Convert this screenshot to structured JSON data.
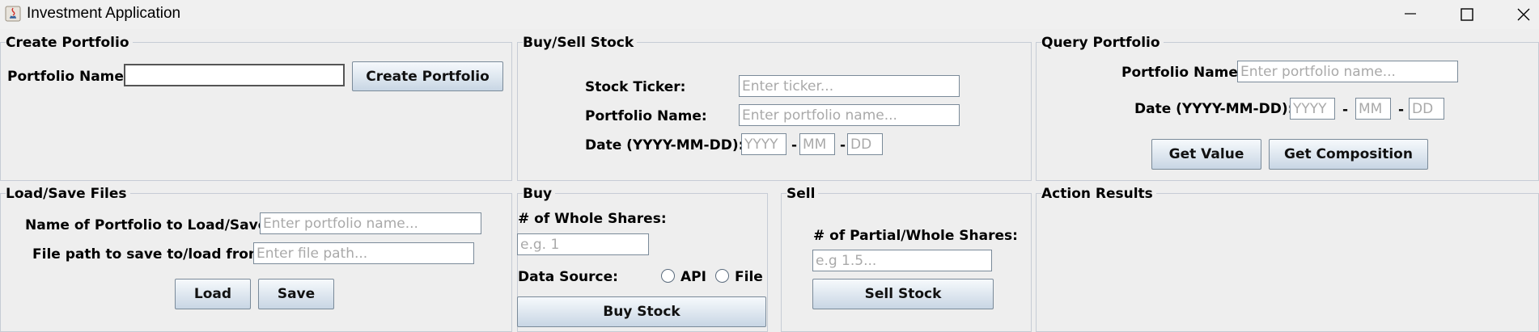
{
  "window": {
    "title": "Investment Application"
  },
  "create_portfolio": {
    "title": "Create Portfolio",
    "name_label": "Portfolio Name:",
    "name_value": "",
    "button": "Create Portfolio"
  },
  "buy_sell": {
    "title": "Buy/Sell Stock",
    "ticker_label": "Stock Ticker:",
    "ticker_placeholder": "Enter ticker...",
    "portfolio_label": "Portfolio Name:",
    "portfolio_placeholder": "Enter portfolio name...",
    "date_label": "Date (YYYY-MM-DD):",
    "year_placeholder": "YYYY",
    "month_placeholder": "MM",
    "day_placeholder": "DD",
    "dash": "-"
  },
  "query": {
    "title": "Query Portfolio",
    "portfolio_label": "Portfolio Name:",
    "portfolio_placeholder": "Enter portfolio name...",
    "date_label": "Date (YYYY-MM-DD):",
    "year_placeholder": "YYYY",
    "month_placeholder": "MM",
    "day_placeholder": "DD",
    "dash": "-",
    "get_value": "Get Value",
    "get_composition": "Get Composition"
  },
  "load_save": {
    "title": "Load/Save Files",
    "name_label": "Name of Portfolio to Load/Save:",
    "name_placeholder": "Enter portfolio name...",
    "path_label": "File path to save to/load from:",
    "path_placeholder": "Enter file path...",
    "load": "Load",
    "save": "Save"
  },
  "buy": {
    "title": "Buy",
    "shares_label": "# of Whole Shares:",
    "shares_placeholder": "e.g. 1",
    "source_label": "Data Source:",
    "api_label": "API",
    "file_label": "File",
    "button": "Buy Stock"
  },
  "sell": {
    "title": "Sell",
    "shares_label": "# of Partial/Whole Shares:",
    "shares_placeholder": "e.g 1.5...",
    "button": "Sell Stock"
  },
  "results": {
    "title": "Action Results"
  }
}
